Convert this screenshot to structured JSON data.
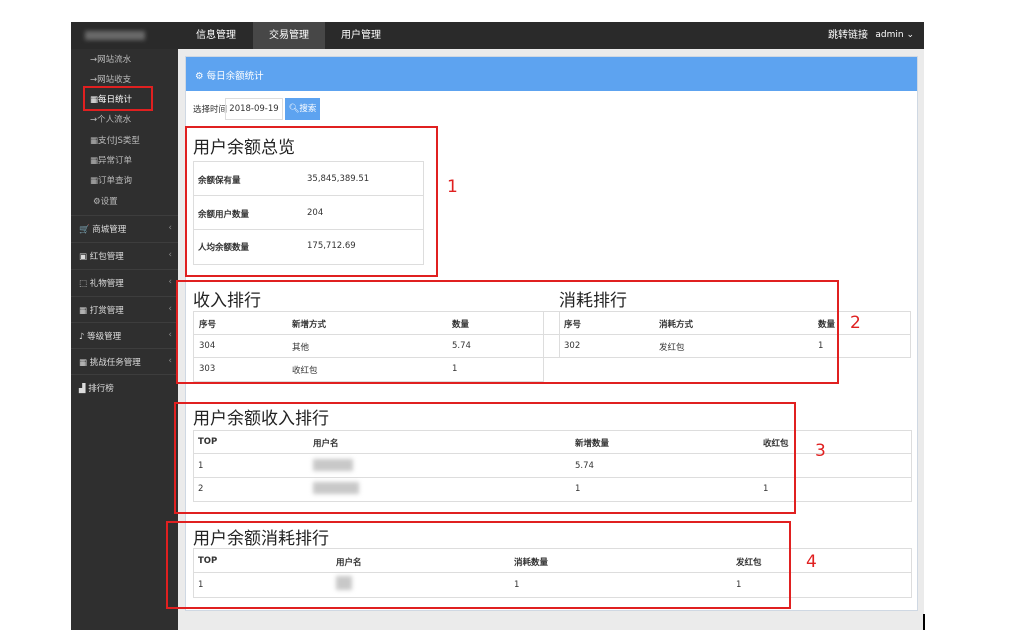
{
  "topbar": {
    "logo_tail": "è",
    "tabs": [
      "信息管理",
      "交易管理",
      "用户管理"
    ],
    "jump_link": "跳转链接",
    "user": "admin ⌄"
  },
  "sidebar": {
    "sub_items": [
      "→网站流水",
      "→网站收支",
      "▦每日统计",
      "→个人流水",
      "▦支付JS类型",
      "▦异常订单",
      "▦订单查询",
      "⚙设置"
    ],
    "sections": [
      "商城管理",
      "红包管理",
      "礼物管理",
      "打赏管理",
      "等级管理",
      "挑战任务管理",
      "排行榜"
    ],
    "section_icons": [
      "cart-icon",
      "gift-box-icon",
      "gift-icon",
      "trophy-icon",
      "level-icon",
      "task-icon",
      "ranking-icon"
    ],
    "section_glyphs": [
      "🛒",
      "▣",
      "⬚",
      "▦",
      "♪",
      "▦",
      "▟"
    ],
    "chevron": "‹"
  },
  "panel": {
    "title": "每日余额统计",
    "date_label": "选择时间",
    "date_value": "2018-09-19",
    "search_label": "搜索"
  },
  "overview": {
    "title": "用户余额总览",
    "rows": [
      {
        "label": "余额保有量",
        "value": "35,845,389.51"
      },
      {
        "label": "余额用户数量",
        "value": "204"
      },
      {
        "label": "人均余额数量",
        "value": "175,712.69"
      }
    ]
  },
  "income_rank": {
    "title": "收入排行",
    "headers": [
      "序号",
      "新增方式",
      "数量"
    ],
    "rows": [
      [
        "304",
        "其他",
        "5.74"
      ],
      [
        "303",
        "收红包",
        "1"
      ]
    ]
  },
  "consume_rank": {
    "title": "消耗排行",
    "headers": [
      "序号",
      "消耗方式",
      "数量"
    ],
    "rows": [
      [
        "302",
        "发红包",
        "1"
      ]
    ]
  },
  "user_income": {
    "title": "用户余额收入排行",
    "headers": [
      "TOP",
      "用户名",
      "新增数量",
      "收红包"
    ],
    "rows": [
      [
        "1",
        "",
        "5.74",
        ""
      ],
      [
        "2",
        "",
        "1",
        "1"
      ]
    ]
  },
  "user_consume": {
    "title": "用户余额消耗排行",
    "headers": [
      "TOP",
      "用户名",
      "消耗数量",
      "发红包"
    ],
    "rows": [
      [
        "1",
        "",
        "1",
        "1"
      ]
    ]
  },
  "annotations": [
    "1",
    "2",
    "3",
    "4"
  ],
  "colors": {
    "accent": "#5da3f0",
    "annotation": "#e02020",
    "nav": "#2a2a2a",
    "sidebar": "#2f2f2f"
  }
}
